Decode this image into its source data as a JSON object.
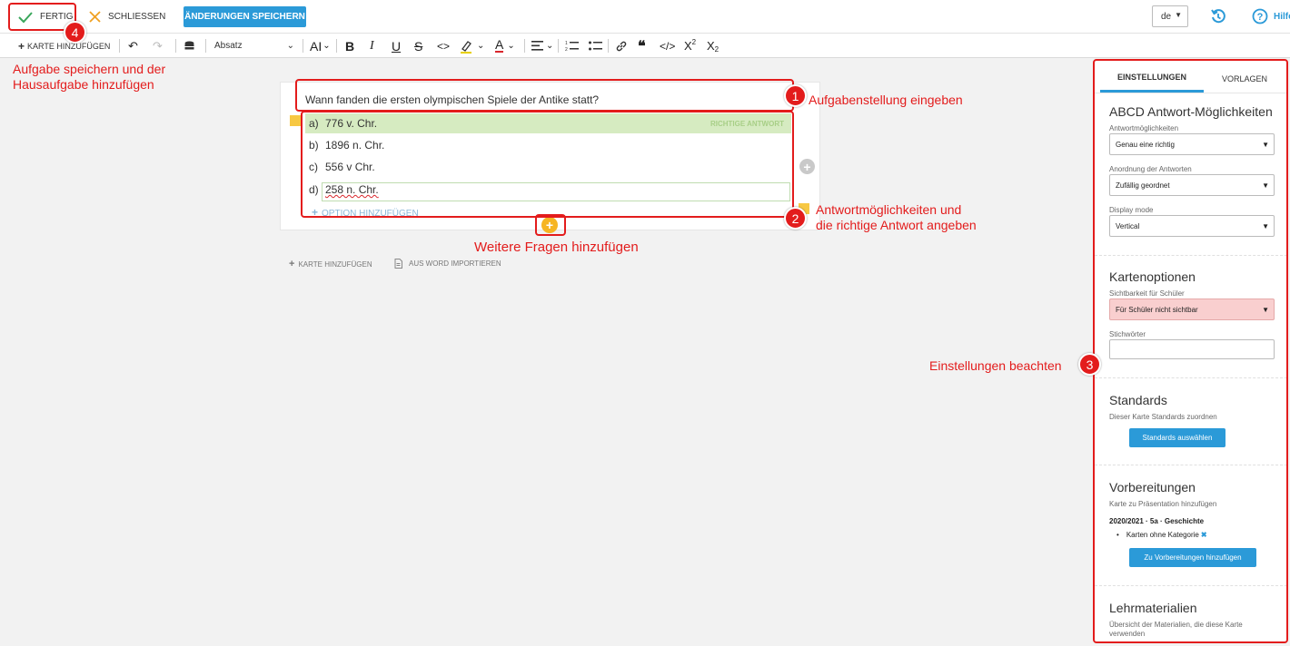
{
  "topbar": {
    "done_label": "FERTIG",
    "close_label": "SCHLIESSEN",
    "save_label": "ÄNDERUNGEN SPEICHERN",
    "language": "de",
    "help_label": "Hilfe"
  },
  "format_toolbar": {
    "add_card_label": "KARTE HINZUFÜGEN",
    "paragraph_style": "Absatz"
  },
  "annotations": {
    "step4_text_line1": "Aufgabe speichern und der",
    "step4_text_line2": "Hausaufgabe hinzufügen",
    "step1_text": "Aufgabenstellung eingeben",
    "step2_text_line1": "Antwortmöglichkeiten und",
    "step2_text_line2": "die richtige Antwort angeben",
    "more_questions_text": "Weitere Fragen hinzufügen",
    "step3_text": "Einstellungen beachten",
    "badges": [
      "1",
      "2",
      "3",
      "4"
    ]
  },
  "card": {
    "question": "Wann fanden die ersten olympischen Spiele der Antike statt?",
    "correct_answer_label": "RICHTIGE ANTWORT",
    "answers": [
      {
        "letter": "a)",
        "text": "776 v. Chr."
      },
      {
        "letter": "b)",
        "text": "1896 n. Chr."
      },
      {
        "letter": "c)",
        "text": "556 v Chr."
      },
      {
        "letter": "d)",
        "text": "258 n. Chr."
      }
    ],
    "add_option_label": "OPTION HINZUFÜGEN"
  },
  "below_card": {
    "add_card_label": "KARTE HINZUFÜGEN",
    "import_word_label": "AUS WORD IMPORTIEREN"
  },
  "panel": {
    "tabs": [
      "EINSTELLUNGEN",
      "VORLAGEN"
    ],
    "abcd": {
      "title": "ABCD Antwort-Möglichkeiten",
      "answer_options_label": "Antwortmöglichkeiten",
      "answer_options_value": "Genau eine richtig",
      "order_label": "Anordnung der Antworten",
      "order_value": "Zufällig geordnet",
      "display_label": "Display mode",
      "display_value": "Vertical"
    },
    "card_options": {
      "title": "Kartenoptionen",
      "visibility_label": "Sichtbarkeit für Schüler",
      "visibility_value": "Für Schüler nicht sichtbar",
      "keywords_label": "Stichwörter"
    },
    "standards": {
      "title": "Standards",
      "desc": "Dieser Karte Standards zuordnen",
      "button": "Standards auswählen"
    },
    "preparations": {
      "title": "Vorbereitungen",
      "desc": "Karte zu Präsentation hinzufügen",
      "course": "2020/2021 · 5a · Geschichte",
      "category": "Karten ohne Kategorie",
      "remove": "✖",
      "button": "Zu Vorbereitungen hinzufügen"
    },
    "materials": {
      "title": "Lehrmaterialien",
      "desc_line1": "Übersicht der Materialien, die diese Karte",
      "desc_line2": "verwenden"
    }
  },
  "colors": {
    "accent": "#2b9ad8",
    "annotation": "#e31c1c",
    "correct_bg": "#d6ebc1",
    "visibility_bg": "#f9cfcf"
  }
}
